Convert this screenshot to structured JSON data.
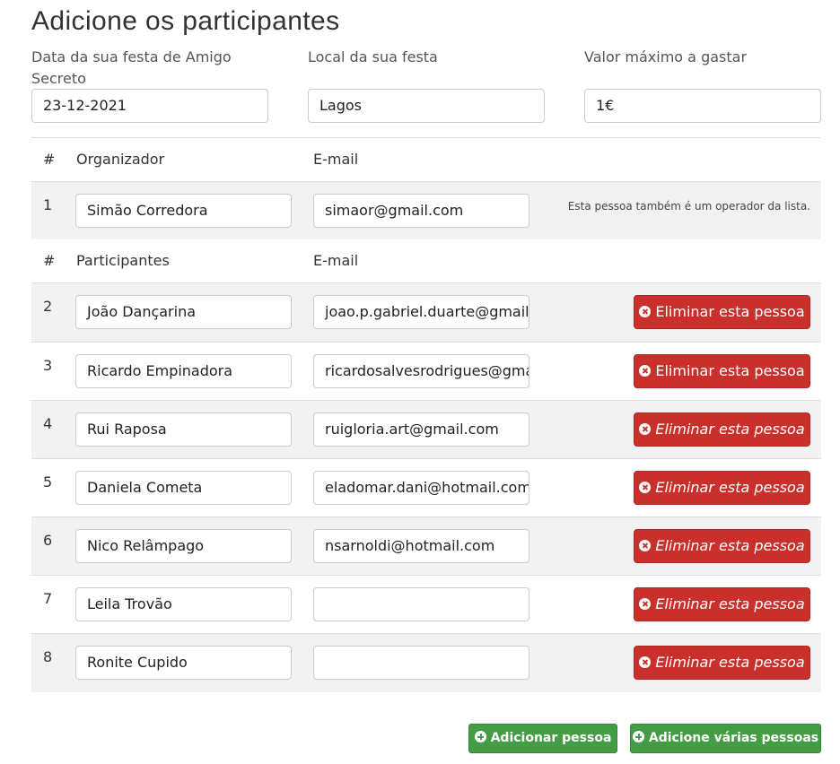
{
  "header": {
    "title": "Adicione os participantes"
  },
  "event": {
    "date_label": "Data da sua festa de Amigo Secreto",
    "date_value": "23-12-2021",
    "place_label": "Local da sua festa",
    "place_value": "Lagos",
    "budget_label": "Valor máximo a gastar",
    "budget_value": "1€"
  },
  "organizer_table": {
    "col_index": "#",
    "col_name": "Organizador",
    "col_email": "E-mail",
    "row": {
      "index": "1",
      "name": "Simão Corredora",
      "email": "simaor@gmail.com",
      "note": "Esta pessoa também é um operador da lista."
    }
  },
  "participants_table": {
    "col_index": "#",
    "col_name": "Participantes",
    "col_email": "E-mail",
    "delete_label": "Eliminar esta pessoa",
    "rows": [
      {
        "index": "2",
        "name": "João Dançarina",
        "email": "joao.p.gabriel.duarte@gmail.com"
      },
      {
        "index": "3",
        "name": "Ricardo Empinadora",
        "email": "ricardosalvesrodrigues@gmail.com"
      },
      {
        "index": "4",
        "name": "Rui Raposa",
        "email": "ruigloria.art@gmail.com"
      },
      {
        "index": "5",
        "name": "Daniela Cometa",
        "email": "eladomar.dani@hotmail.com"
      },
      {
        "index": "6",
        "name": "Nico Relâmpago",
        "email": "nsarnoldi@hotmail.com"
      },
      {
        "index": "7",
        "name": "Leila Trovão",
        "email": ""
      },
      {
        "index": "8",
        "name": "Ronite Cupido",
        "email": ""
      }
    ]
  },
  "actions": {
    "add_person": "Adicionar pessoa",
    "add_many": "Adicione várias pessoas"
  },
  "colors": {
    "danger": "#c9302c",
    "success": "#449d44",
    "row_shade": "#f2f2f2"
  }
}
